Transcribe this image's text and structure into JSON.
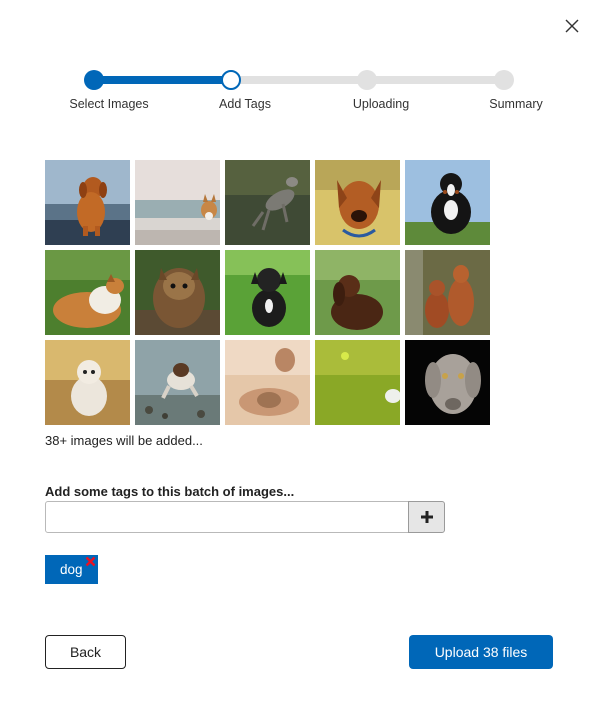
{
  "dialog": {
    "close_icon": "close-icon"
  },
  "stepper": {
    "current_step": 2,
    "steps": [
      {
        "label": "Select Images",
        "status": "done"
      },
      {
        "label": "Add Tags",
        "status": "current"
      },
      {
        "label": "Uploading",
        "status": "todo"
      },
      {
        "label": "Summary",
        "status": "todo"
      }
    ],
    "accent_color": "#0067b8",
    "inactive_color": "#e1e1e1"
  },
  "images": {
    "thumbnails": [
      {
        "subject": "golden-dog-at-beach"
      },
      {
        "subject": "corgi-on-pier"
      },
      {
        "subject": "running-grey-dog"
      },
      {
        "subject": "dachshund-with-collar"
      },
      {
        "subject": "bernese-mountain-dog"
      },
      {
        "subject": "rough-collie"
      },
      {
        "subject": "yorkshire-terrier"
      },
      {
        "subject": "black-puppy-on-grass"
      },
      {
        "subject": "brown-spaniel"
      },
      {
        "subject": "two-brown-dogs"
      },
      {
        "subject": "white-fluffy-dog"
      },
      {
        "subject": "dog-running-in-water"
      },
      {
        "subject": "sleeping-bulldog"
      },
      {
        "subject": "dog-with-ball-on-lawn"
      },
      {
        "subject": "weimaraner"
      }
    ],
    "count_text": "38+ images will be added..."
  },
  "tags": {
    "label": "Add some tags to this batch of images...",
    "input_value": "",
    "add_button_label": "+",
    "items": [
      {
        "label": "dog",
        "remove_icon": "remove-x-icon",
        "remove_color": "#e81123"
      }
    ]
  },
  "footer": {
    "back_label": "Back",
    "upload_label": "Upload 38 files",
    "primary_color": "#0067b8"
  }
}
